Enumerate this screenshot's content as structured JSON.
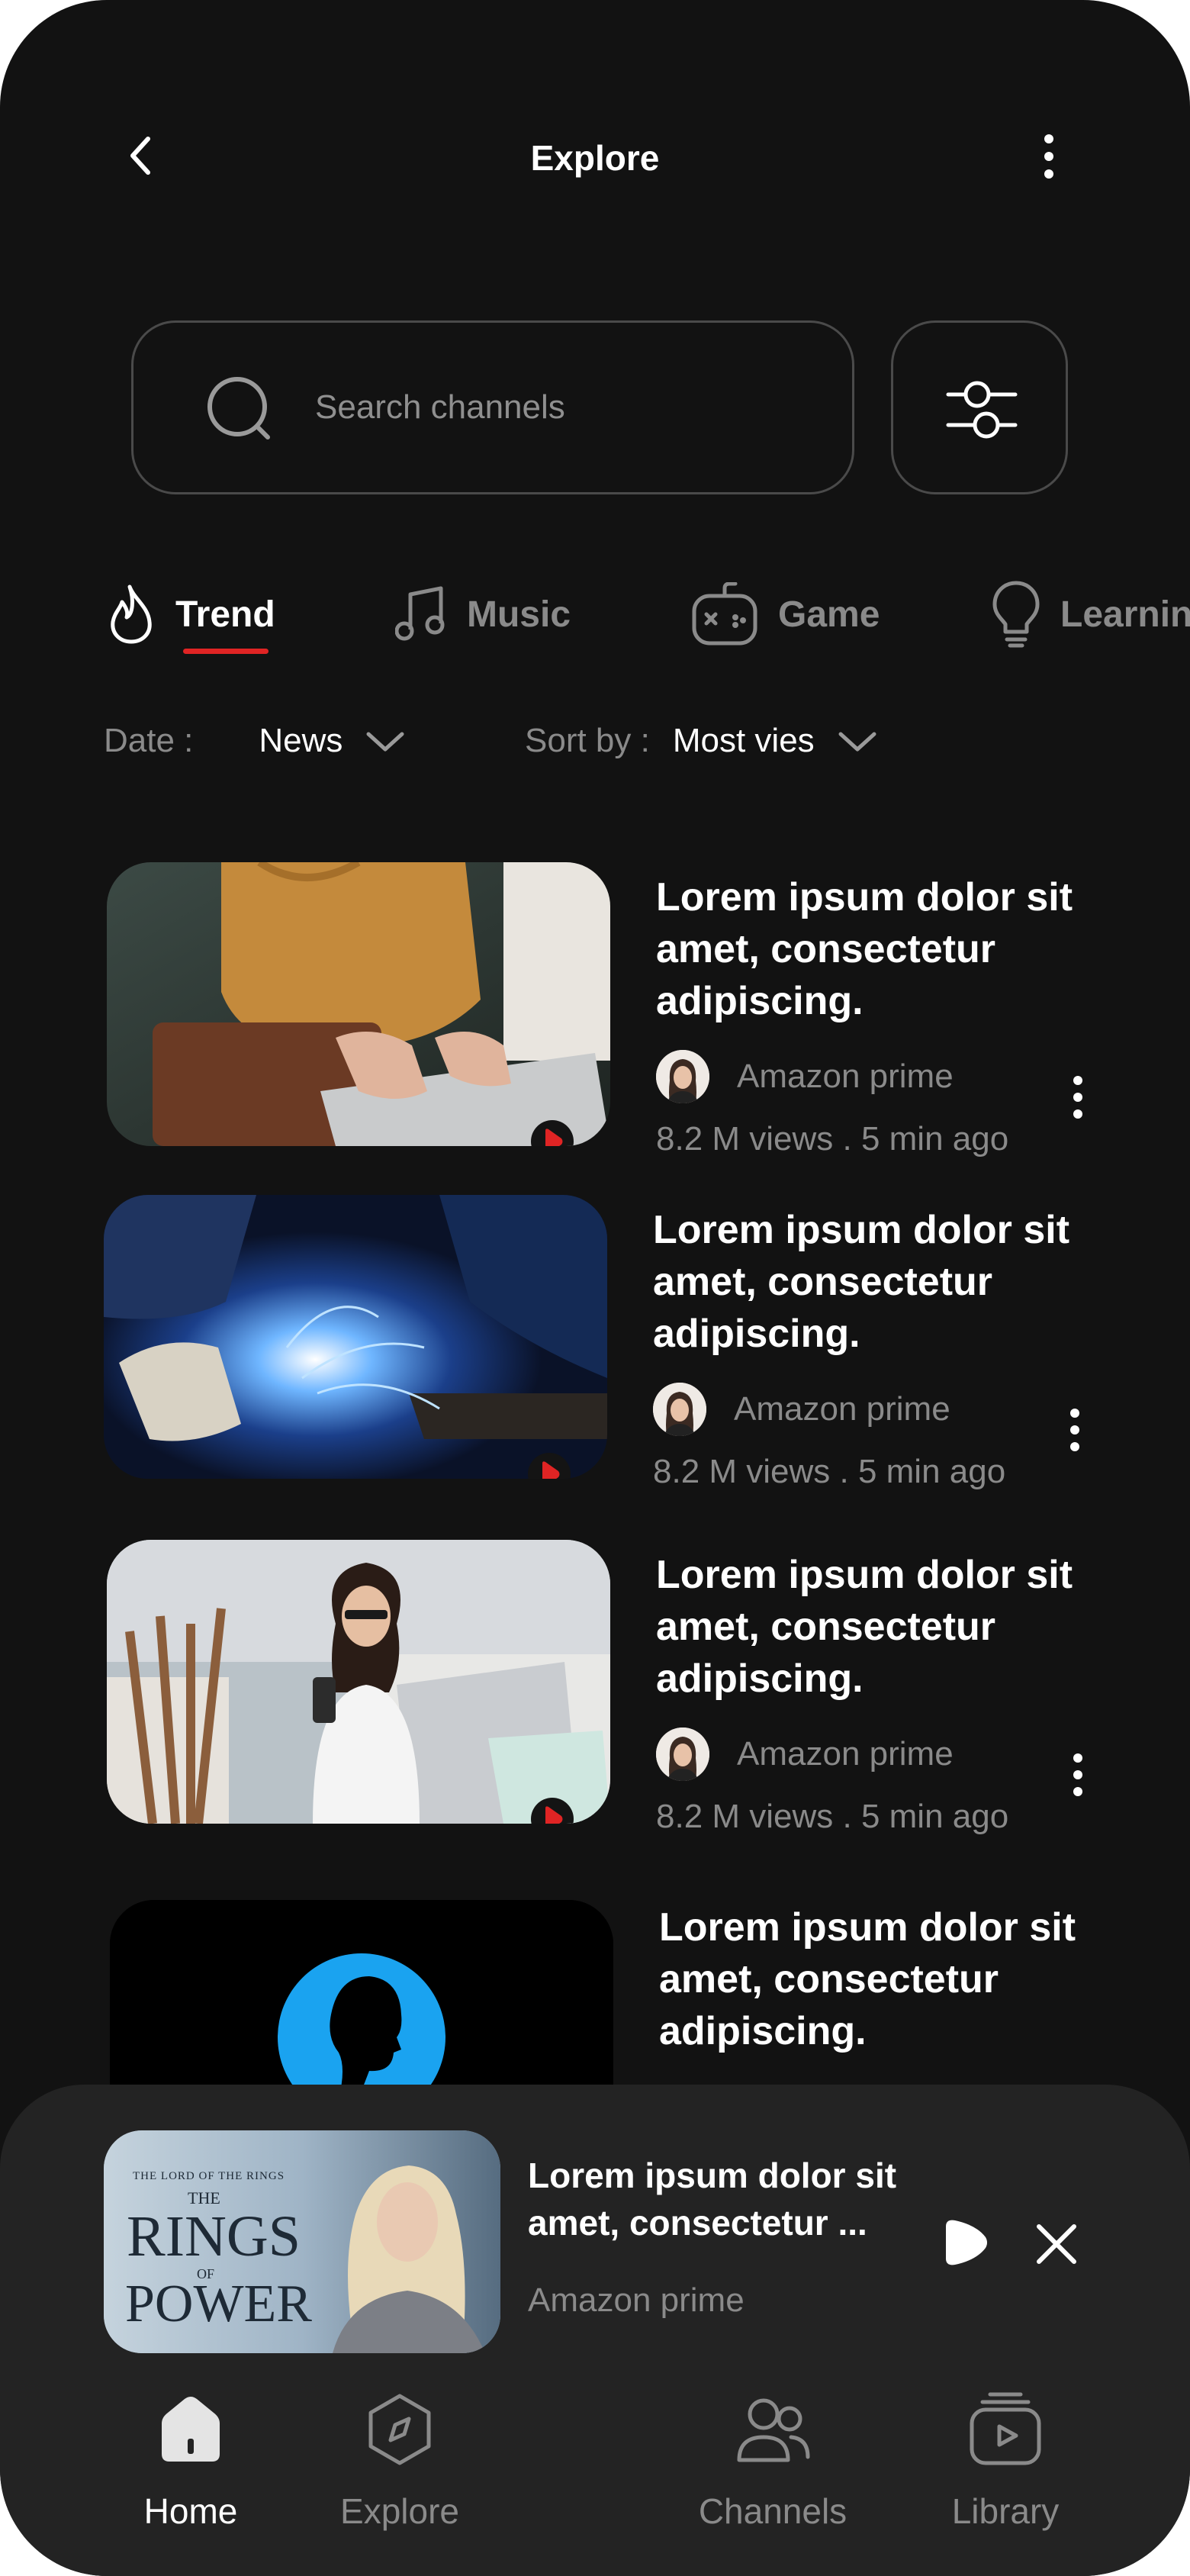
{
  "header": {
    "title": "Explore"
  },
  "search": {
    "placeholder": "Search channels"
  },
  "tabs": [
    {
      "label": "Trend",
      "active": true
    },
    {
      "label": "Music"
    },
    {
      "label": "Game"
    },
    {
      "label": "Learning"
    }
  ],
  "filters": {
    "date_label": "Date :",
    "date_value": "News",
    "sort_label": "Sort by :",
    "sort_value": "Most vies"
  },
  "videos": [
    {
      "title": "Lorem ipsum dolor sit amet, consectetur adipiscing.",
      "channel": "Amazon prime",
      "meta": "8.2 M views . 5 min ago",
      "thumb": "laptop-typing"
    },
    {
      "title": "Lorem ipsum dolor sit amet, consectetur adipiscing.",
      "channel": "Amazon prime",
      "meta": "8.2 M views . 5 min ago",
      "thumb": "welding"
    },
    {
      "title": "Lorem ipsum dolor sit amet, consectetur adipiscing.",
      "channel": "Amazon prime",
      "meta": "8.2 M views . 5 min ago",
      "thumb": "woman-phone"
    },
    {
      "title": "Lorem ipsum dolor sit amet, consectetur adipiscing.",
      "thumb": "avatar-silhouette"
    }
  ],
  "mini_player": {
    "poster_line1": "THE LORD OF THE RINGS",
    "poster_line2": "THE",
    "poster_line3": "RINGS",
    "poster_line4": "OF",
    "poster_line5": "POWER",
    "title": "Lorem ipsum dolor sit amet, consectetur ...",
    "channel": "Amazon prime"
  },
  "bottom_nav": [
    {
      "label": "Home",
      "icon": "home-icon",
      "active": true
    },
    {
      "label": "Explore",
      "icon": "compass-icon"
    },
    {
      "label": "Channels",
      "icon": "users-icon"
    },
    {
      "label": "Library",
      "icon": "library-icon"
    }
  ],
  "colors": {
    "background": "#121212",
    "accent": "#e02424",
    "muted": "#8a8a8a",
    "avatar_blue": "#1aa3f0"
  }
}
